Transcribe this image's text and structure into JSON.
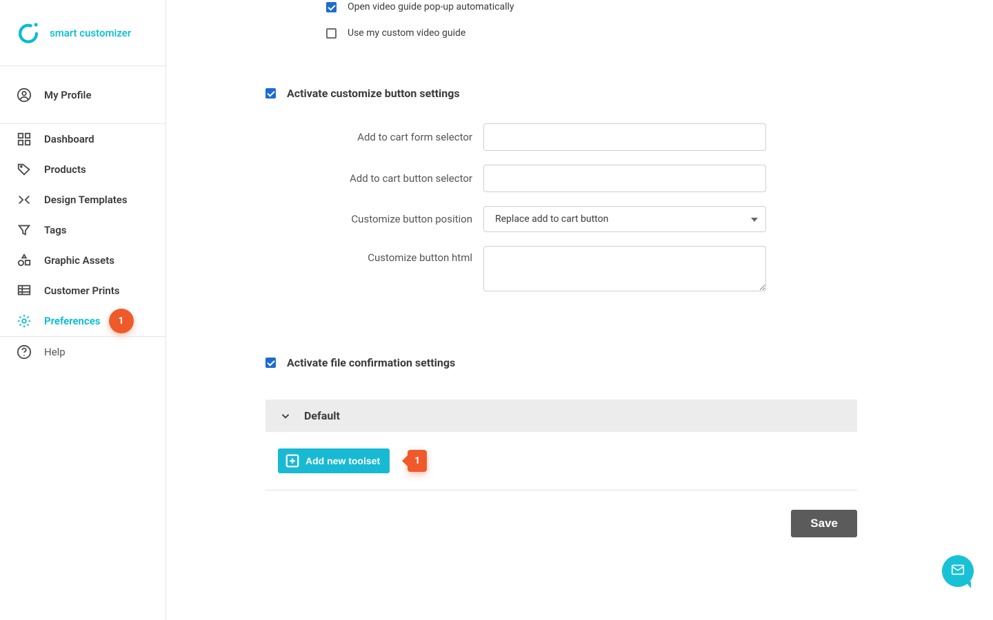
{
  "app_name": "smart customizer",
  "sidebar": {
    "profile_label": "My Profile",
    "items": [
      {
        "label": "Dashboard",
        "icon": "dashboard"
      },
      {
        "label": "Products",
        "icon": "tag"
      },
      {
        "label": "Design Templates",
        "icon": "templates"
      },
      {
        "label": "Tags",
        "icon": "filter"
      },
      {
        "label": "Graphic Assets",
        "icon": "assets"
      },
      {
        "label": "Customer Prints",
        "icon": "prints"
      },
      {
        "label": "Preferences",
        "icon": "gear",
        "active": true,
        "badge": "1"
      }
    ],
    "help_label": "Help"
  },
  "video_guide": {
    "open_auto_label": "Open video guide pop-up automatically",
    "open_auto_checked": true,
    "use_custom_label": "Use my custom video guide",
    "use_custom_checked": false
  },
  "customize_button": {
    "heading": "Activate customize button settings",
    "checked": true,
    "fields": {
      "form_selector_label": "Add to cart form selector",
      "form_selector_value": "",
      "button_selector_label": "Add to cart button selector",
      "button_selector_value": "",
      "position_label": "Customize button position",
      "position_value": "Replace add to cart button",
      "html_label": "Customize button html",
      "html_value": ""
    }
  },
  "file_confirmation": {
    "heading": "Activate file confirmation settings",
    "checked": true
  },
  "collapse_default_label": "Default",
  "add_toolset_label": "Add new toolset",
  "add_toolset_badge": "1",
  "save_label": "Save"
}
